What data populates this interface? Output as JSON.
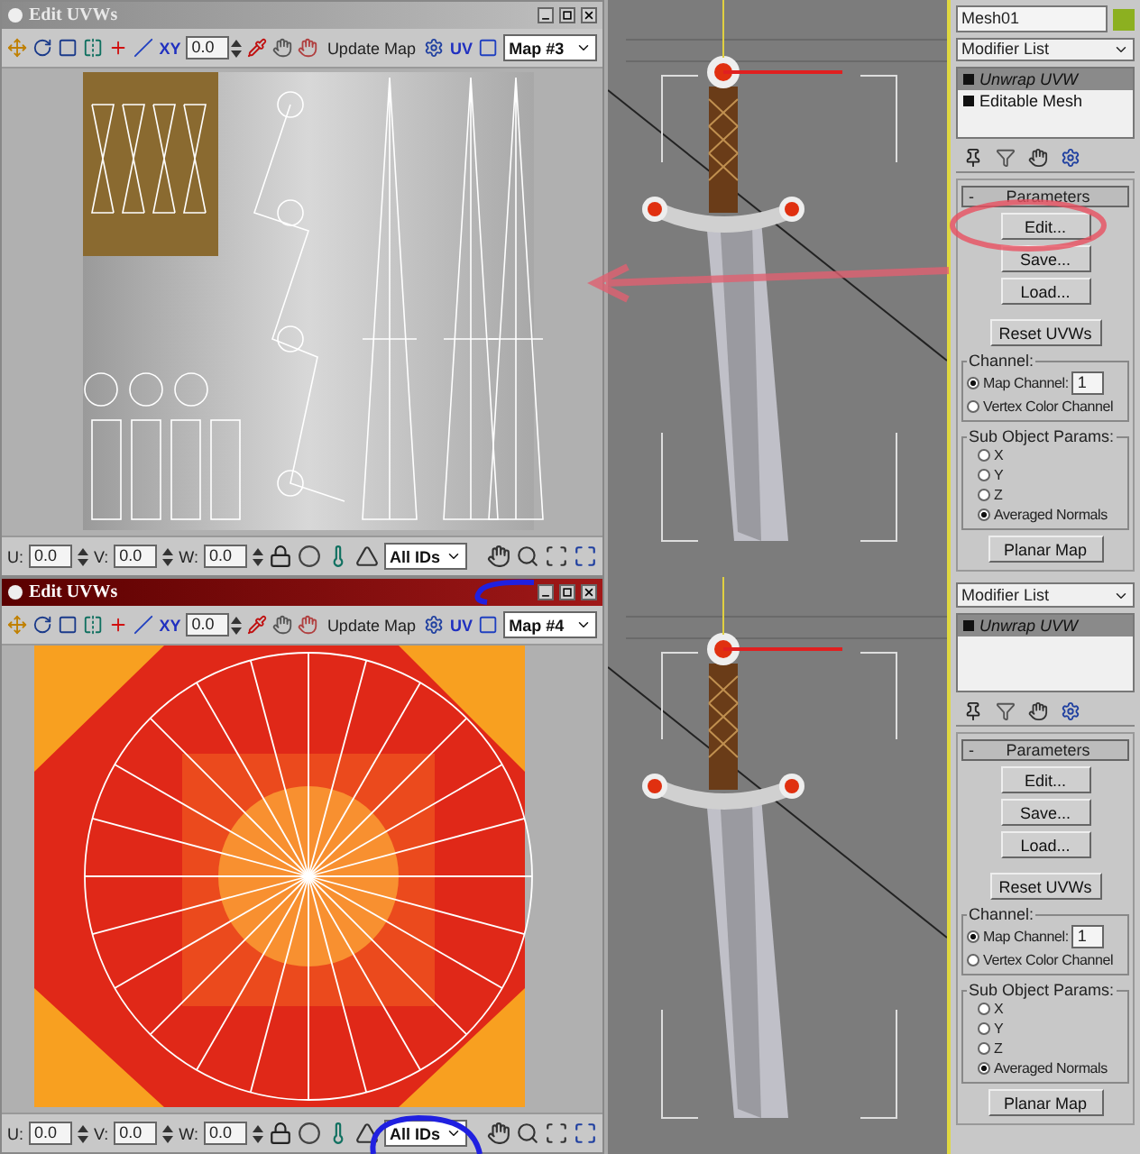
{
  "panes": [
    {
      "uvw_editor": {
        "title": "Edit UVWs",
        "active": false,
        "axis_label": "XY",
        "spinner": "0.0",
        "update_button": "Update Map",
        "uv_label": "UV",
        "map": "Map #3",
        "u_label": "U:",
        "u": "0.0",
        "v_label": "V:",
        "v": "0.0",
        "w_label": "W:",
        "w": "0.0",
        "id_filter": "All IDs"
      },
      "panel": {
        "object_name": "Mesh01",
        "modifier_list": "Modifier List",
        "stack": [
          {
            "label": "Unwrap UVW",
            "selected": true
          },
          {
            "label": "Editable Mesh",
            "selected": false
          }
        ],
        "rollout_toggle": "-",
        "rollout_title": "Parameters",
        "file_buttons": [
          "Edit...",
          "Save...",
          "Load..."
        ],
        "reset_button": "Reset UVWs",
        "channel_title": "Channel:",
        "channel_options": [
          {
            "label": "Map Channel:",
            "selected": true,
            "value": "1"
          },
          {
            "label": "Vertex Color Channel",
            "selected": false
          }
        ],
        "sub_object_title": "Sub Object Params:",
        "sub_object_options": [
          {
            "label": "X",
            "selected": false
          },
          {
            "label": "Y",
            "selected": false
          },
          {
            "label": "Z",
            "selected": false
          },
          {
            "label": "Averaged Normals",
            "selected": true
          }
        ],
        "planar_button": "Planar Map"
      }
    },
    {
      "uvw_editor": {
        "title": "Edit UVWs",
        "active": true,
        "axis_label": "XY",
        "spinner": "0.0",
        "update_button": "Update Map",
        "uv_label": "UV",
        "map": "Map #4",
        "u_label": "U:",
        "u": "0.0",
        "v_label": "V:",
        "v": "0.0",
        "w_label": "W:",
        "w": "0.0",
        "id_filter": "All IDs"
      },
      "panel": {
        "modifier_list": "Modifier List",
        "stack": [
          {
            "label": "Unwrap UVW",
            "selected": true
          }
        ],
        "rollout_toggle": "-",
        "rollout_title": "Parameters",
        "file_buttons": [
          "Edit...",
          "Save...",
          "Load..."
        ],
        "reset_button": "Reset UVWs",
        "channel_title": "Channel:",
        "channel_options": [
          {
            "label": "Map Channel:",
            "selected": true,
            "value": "1"
          },
          {
            "label": "Vertex Color Channel",
            "selected": false
          }
        ],
        "sub_object_title": "Sub Object Params:",
        "sub_object_options": [
          {
            "label": "X",
            "selected": false
          },
          {
            "label": "Y",
            "selected": false
          },
          {
            "label": "Z",
            "selected": false
          },
          {
            "label": "Averaged Normals",
            "selected": true
          }
        ],
        "planar_button": "Planar Map"
      }
    }
  ]
}
